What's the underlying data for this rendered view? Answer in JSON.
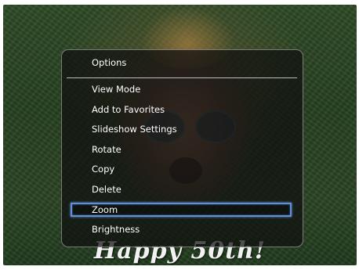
{
  "photo": {
    "caption": "Happy 50th!"
  },
  "menu": {
    "title": "Options",
    "items": [
      {
        "label": "View Mode"
      },
      {
        "label": "Add to Favorites"
      },
      {
        "label": "Slideshow Settings"
      },
      {
        "label": "Rotate"
      },
      {
        "label": "Copy"
      },
      {
        "label": "Delete"
      },
      {
        "label": "Zoom",
        "selected": true
      },
      {
        "label": "Brightness"
      }
    ],
    "selected_index": 6
  },
  "colors": {
    "highlight": "#5e8fd8",
    "menu_bg": "#0f0f0f",
    "text": "#ffffff"
  }
}
